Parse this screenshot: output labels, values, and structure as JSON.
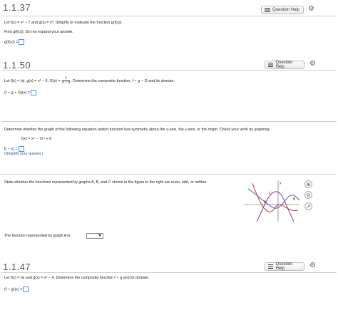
{
  "help_label": "Question Help",
  "q1": {
    "title": "1.1.37",
    "line1": "Let f(x) = x² − 7 and g(x) = x⁶. Simplify or evaluate the function g(f(u)).",
    "line2": "Find g(f(u)). Do not expand your answer.",
    "answer_label": "g(f(u)) ="
  },
  "q2": {
    "title": "1.1.50",
    "line1_a": "Let f(x) = |x|, g(x) = x² − 6, G(x) =",
    "frac_num": "1",
    "frac_den": "x − 9",
    "line1_b": ". Determine the composite function, f ∘ g ∘ G and its domain.",
    "answer_label": "(f ∘ g ∘ G)(x) ="
  },
  "q3": {
    "line1": "Determine whether the graph of the following equation and/or function has symmetry about the x-axis, the y-axis, or the origin. Check your work by graphing.",
    "equation": "f(x) = x⁶ − 7x⁴ + 8",
    "answer_label": "f( − x) =",
    "hint": "(Simplify your answer.)"
  },
  "q4": {
    "line1": "State whether the functions represented by graphs A, B, and C shown in the figure to the right are even, odd, or neither.",
    "answer_label": "The function represented by graph A is",
    "select_value": "",
    "graph_labels": {
      "a": "A",
      "b": "B",
      "c": "C",
      "y": "y"
    }
  },
  "q5": {
    "title": "1.1.47",
    "line1": "Let f(x) = |x| and g(x) = x² − 4. Determine the composite function f ∘ g and its domain.",
    "answer_label": "(f ∘ g)(x) ="
  },
  "icons": [
    "list-icon",
    "gear-icon",
    "zoom-in-icon",
    "zoom-out-icon",
    "external-link-icon",
    "dropdown-arrow-icon"
  ],
  "colors": {
    "accent": "#4a90d9",
    "hint_blue": "#1b4f9c",
    "graph_blue": "#3a57c4",
    "graph_red": "#c0392b",
    "graph_purple": "#7b3fa0"
  }
}
